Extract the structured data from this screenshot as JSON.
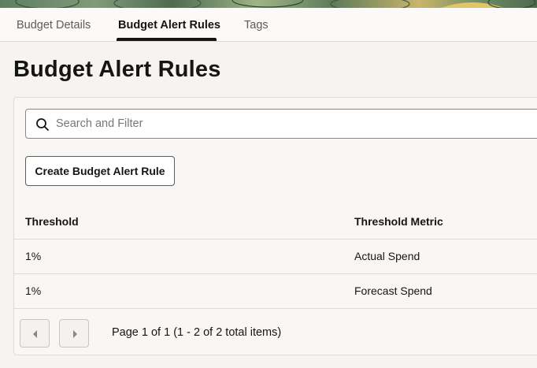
{
  "colors": {
    "accent": "#161513",
    "panel_background": "#f8f7f5",
    "border": "#dcdad6"
  },
  "tabs": [
    {
      "label": "Budget Details",
      "active": false
    },
    {
      "label": "Budget Alert Rules",
      "active": true
    },
    {
      "label": "Tags",
      "active": false
    }
  ],
  "page": {
    "title": "Budget Alert Rules"
  },
  "search": {
    "placeholder": "Search and Filter",
    "value": "",
    "icon": "search-icon"
  },
  "toolbar": {
    "create_label": "Create Budget Alert Rule"
  },
  "table": {
    "columns": [
      "Threshold",
      "Threshold Metric"
    ],
    "rows": [
      [
        "1%",
        "Actual Spend"
      ],
      [
        "1%",
        "Forecast Spend"
      ]
    ]
  },
  "pagination": {
    "summary": "Page 1 of 1 (1 - 2 of 2 total items)",
    "prev_icon": "chevron-left-icon",
    "next_icon": "chevron-right-icon"
  }
}
